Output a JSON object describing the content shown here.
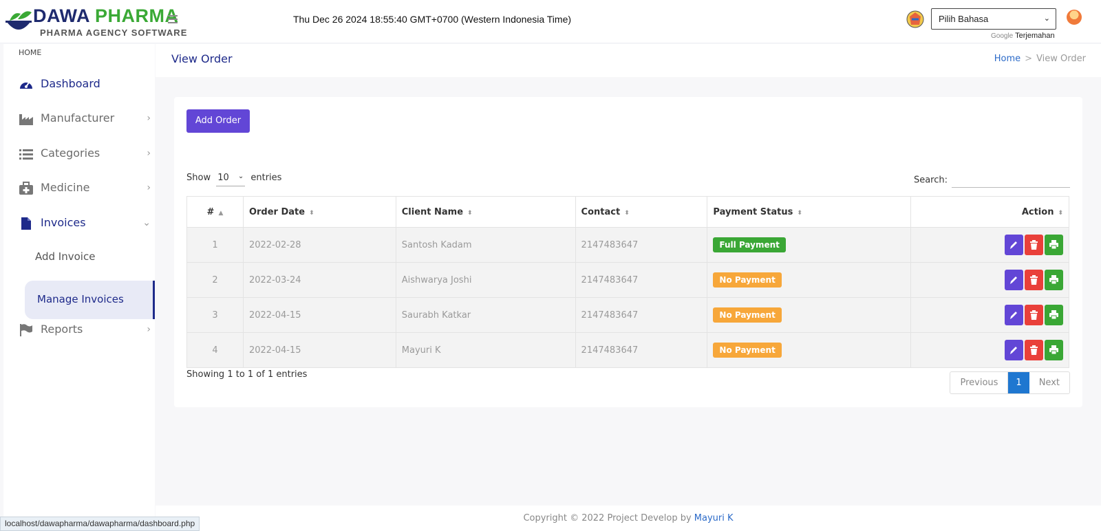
{
  "logo": {
    "brand_dark": "DAWA",
    "brand_green": "PHARMA",
    "subtitle": "PHARMA AGENCY SOFTWARE"
  },
  "header": {
    "clock": "Thu Dec 26 2024 18:55:40 GMT+0700 (Western Indonesia Time)",
    "language_select": "Pilih Bahasa",
    "powered_google": "Google",
    "powered_label": "Terjemahan"
  },
  "sidebar": {
    "section": "HOME",
    "items": [
      {
        "label": "Dashboard",
        "icon": "dashboard-icon"
      },
      {
        "label": "Manufacturer",
        "icon": "factory-icon"
      },
      {
        "label": "Categories",
        "icon": "list-icon"
      },
      {
        "label": "Medicine",
        "icon": "medkit-icon"
      },
      {
        "label": "Invoices",
        "icon": "file-icon"
      },
      {
        "label": "Reports",
        "icon": "flag-icon"
      }
    ],
    "submenu": {
      "add": "Add Invoice",
      "manage": "Manage Invoices"
    }
  },
  "page": {
    "title": "View Order",
    "breadcrumb": {
      "home": "Home",
      "sep": ">",
      "current": "View Order"
    }
  },
  "toolbar": {
    "add_label": "Add Order"
  },
  "table_controls": {
    "show": "Show",
    "entries_value": "10",
    "entries": "entries",
    "search_label": "Search:"
  },
  "table": {
    "columns": [
      "#",
      "Order Date",
      "Client Name",
      "Contact",
      "Payment Status",
      "Action"
    ],
    "rows": [
      {
        "num": "1",
        "date": "2022-02-28",
        "client": "Santosh Kadam",
        "contact": "2147483647",
        "status": "Full Payment"
      },
      {
        "num": "2",
        "date": "2022-03-24",
        "client": "Aishwarya Joshi",
        "contact": "2147483647",
        "status": "No Payment"
      },
      {
        "num": "3",
        "date": "2022-04-15",
        "client": "Saurabh Katkar",
        "contact": "2147483647",
        "status": "No Payment"
      },
      {
        "num": "4",
        "date": "2022-04-15",
        "client": "Mayuri K",
        "contact": "2147483647",
        "status": "No Payment"
      }
    ]
  },
  "pagination": {
    "info": "Showing 1 to 1 of 1 entries",
    "previous": "Previous",
    "current": "1",
    "next": "Next"
  },
  "footer": {
    "text": "Copyright © 2022 Project Develop by ",
    "author": "Mayuri K"
  },
  "status_bar": {
    "url": "localhost/dawapharma/dawapharma/dashboard.php"
  },
  "colors": {
    "primary": "#6246d6",
    "success": "#3aa735",
    "warning": "#f7a73a",
    "danger": "#e9403a",
    "nav_active": "#1e2a8a"
  }
}
